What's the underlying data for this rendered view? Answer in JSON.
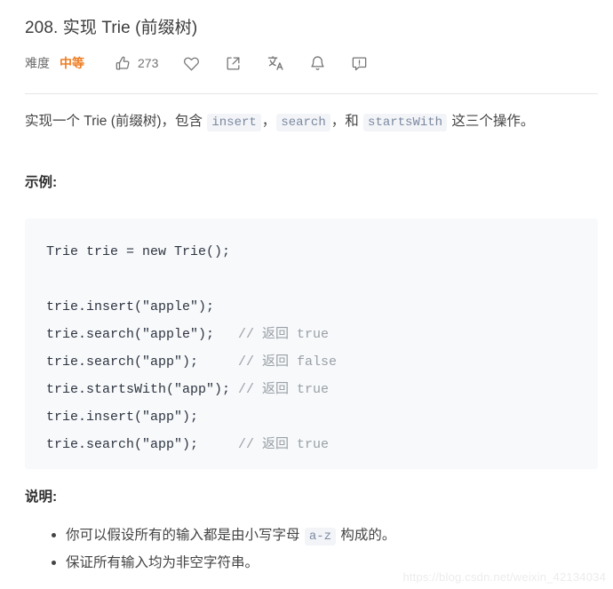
{
  "problem": {
    "title": "208. 实现 Trie (前缀树)",
    "difficulty_label": "难度",
    "difficulty_value": "中等",
    "difficulty_color": "#ef7d24",
    "vote_count": "273"
  },
  "actions": [
    {
      "name": "thumbs-up-icon",
      "label": "273"
    },
    {
      "name": "heart-icon",
      "label": ""
    },
    {
      "name": "share-icon",
      "label": ""
    },
    {
      "name": "translate-icon",
      "label": ""
    },
    {
      "name": "bell-icon",
      "label": ""
    },
    {
      "name": "comment-icon",
      "label": ""
    }
  ],
  "description": {
    "part1": "实现一个 Trie (前缀树)，包含 ",
    "code1": "insert",
    "part2": "，",
    "code2": "search",
    "part3": "，和 ",
    "code3": "startsWith",
    "part4": " 这三个操作。"
  },
  "headings": {
    "example": "示例:",
    "notes": "说明:"
  },
  "code_block": {
    "line1": "Trie trie = new Trie();",
    "line2": "",
    "line3": "trie.insert(\"apple\");",
    "line4_code": "trie.search(\"apple\");   ",
    "line4_comment": "// 返回 true",
    "line5_code": "trie.search(\"app\");     ",
    "line5_comment": "// 返回 false",
    "line6_code": "trie.startsWith(\"app\"); ",
    "line6_comment": "// 返回 true",
    "line7": "trie.insert(\"app\");",
    "line8_code": "trie.search(\"app\");     ",
    "line8_comment": "// 返回 true"
  },
  "notes": {
    "item1_part1": "你可以假设所有的输入都是由小写字母 ",
    "item1_code": "a-z",
    "item1_part2": " 构成的。",
    "item2": "保证所有输入均为非空字符串。"
  },
  "watermark": "https://blog.csdn.net/weixin_42134034"
}
